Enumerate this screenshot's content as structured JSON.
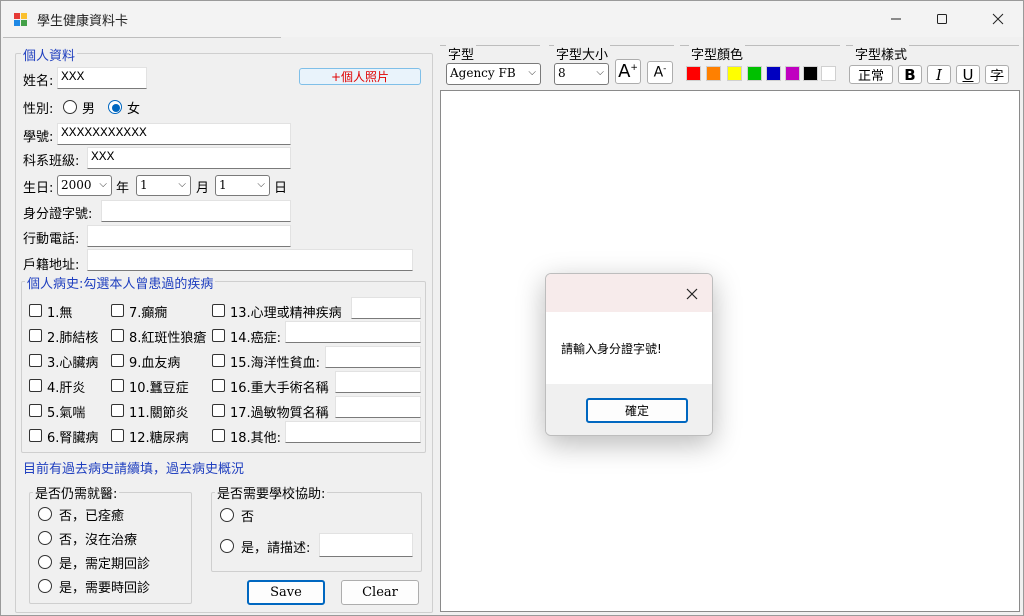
{
  "window": {
    "title": "學生健康資料卡",
    "controls": {
      "minimize_icon": "minimize-icon",
      "maximize_icon": "maximize-icon",
      "close_icon": "close-icon"
    }
  },
  "personal": {
    "group_title": "個人資料",
    "name_label": "姓名:",
    "name_value": "XXX",
    "photo_button": "+個人照片",
    "gender_label": "性別:",
    "gender_male": "男",
    "gender_female": "女",
    "gender_selected": "女",
    "student_id_label": "學號:",
    "student_id_value": "XXXXXXXXXXX",
    "class_label": "科系班級:",
    "class_value": "XXX",
    "birthday_label": "生日:",
    "birth_year": "2000",
    "year_label": "年",
    "birth_month": "1",
    "month_label": "月",
    "birth_day": "1",
    "day_label": "日",
    "id_label": "身分證字號:",
    "id_value": "",
    "phone_label": "行動電話:",
    "phone_value": "",
    "address_label": "戶籍地址:",
    "address_value": ""
  },
  "history": {
    "group_title": "個人病史:勾選本人曾患過的疾病",
    "col1": [
      "1.無",
      "2.肺結核",
      "3.心臟病",
      "4.肝炎",
      "5.氣喘",
      "6.腎臟病"
    ],
    "col2": [
      "7.癲癇",
      "8.紅斑性狼瘡",
      "9.血友病",
      "10.蠶豆症",
      "11.關節炎",
      "12.糖尿病"
    ],
    "col3": [
      "13.心理或精神疾病",
      "14.癌症:",
      "15.海洋性貧血:",
      "16.重大手術名稱",
      "17.過敏物質名稱",
      "18.其他:"
    ]
  },
  "past": {
    "note": "目前有過去病史請續填，過去病史概況",
    "medical_title": "是否仍需就醫:",
    "medical_options": [
      "否，已痊癒",
      "否，沒在治療",
      "是，需定期回診",
      "是，需要時回診"
    ],
    "school_title": "是否需要學校協助:",
    "school_no": "否",
    "school_yes": "是，請描述:"
  },
  "buttons": {
    "save": "Save",
    "clear": "Clear"
  },
  "toolbar": {
    "font_label": "字型",
    "font_value": "Agency FB",
    "size_label": "字型大小",
    "size_value": "8",
    "grow_icon": "font-grow-icon",
    "shrink_icon": "font-shrink-icon",
    "color_label": "字型顏色",
    "colors": [
      "#ff0000",
      "#ff8000",
      "#ffff00",
      "#00c000",
      "#0000c0",
      "#c000c0",
      "#000000",
      "#ffffff"
    ],
    "style_label": "字型樣式",
    "style_regular": "正常",
    "bold": "B",
    "italic": "I",
    "underline": "U",
    "strike": "字"
  },
  "dialog": {
    "message": "請輸入身分證字號!",
    "ok": "確定"
  }
}
